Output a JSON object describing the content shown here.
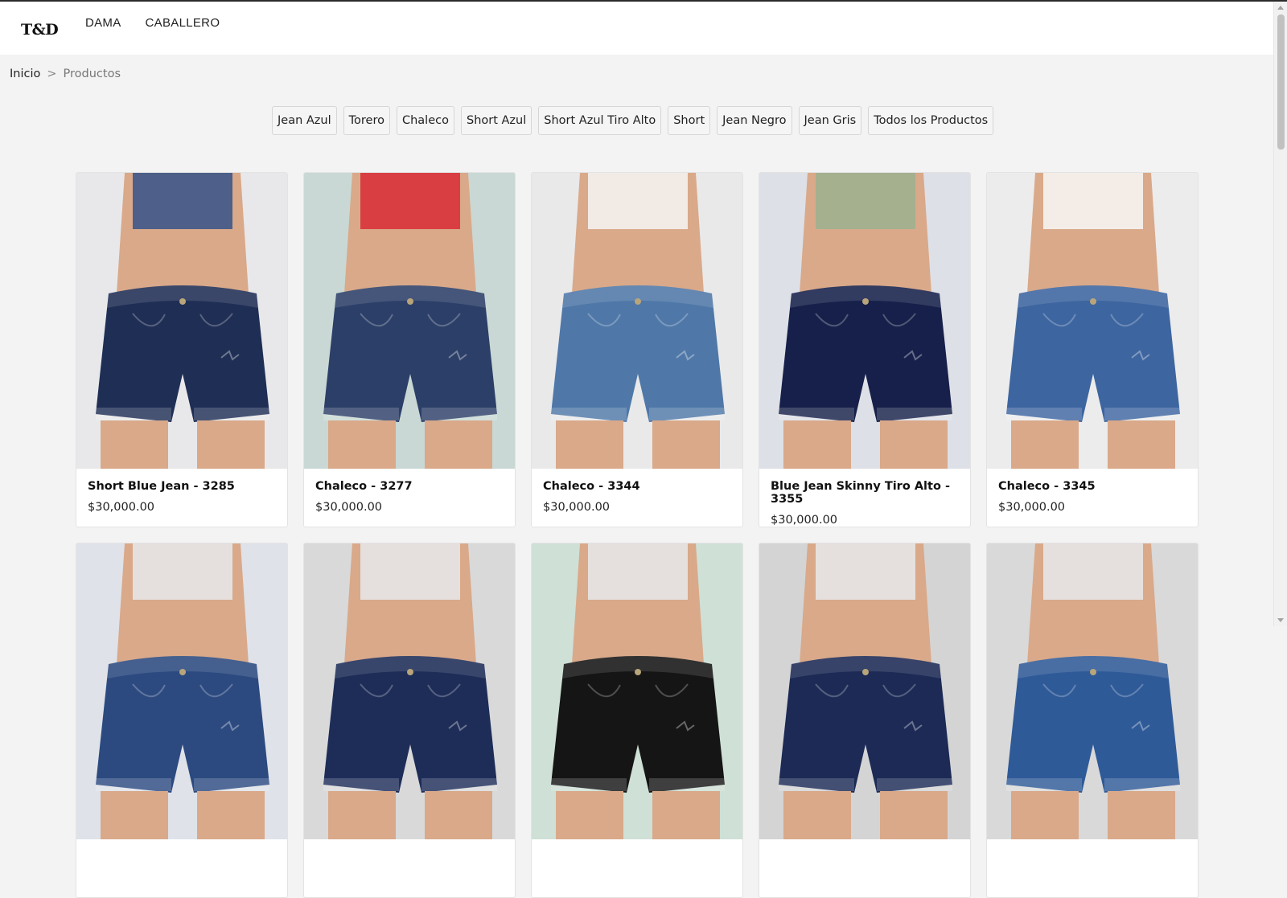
{
  "header": {
    "logo": "T&D",
    "nav": [
      "DAMA",
      "CABALLERO"
    ]
  },
  "breadcrumb": {
    "home": "Inicio",
    "separator": ">",
    "current": "Productos"
  },
  "filters": [
    "Jean Azul",
    "Torero",
    "Chaleco",
    "Short Azul",
    "Short Azul Tiro Alto",
    "Short",
    "Jean Negro",
    "Jean Gris",
    "Todos los Productos"
  ],
  "products": [
    {
      "title": "Short Blue Jean - 3285",
      "price": "$30,000.00",
      "bg": "#e8e8ea",
      "denim": "#1f2e55",
      "accent": "#3e5688"
    },
    {
      "title": "Chaleco - 3277",
      "price": "$30,000.00",
      "bg": "#c9d8d4",
      "denim": "#2c3f68",
      "accent": "#d8323a"
    },
    {
      "title": "Chaleco - 3344",
      "price": "$30,000.00",
      "bg": "#e9e9ea",
      "denim": "#4f78a8",
      "accent": "#f4f1ee"
    },
    {
      "title": "Blue Jean Skinny Tiro Alto - 3355",
      "price": "$30,000.00",
      "bg": "#dde0e6",
      "denim": "#16204a",
      "accent": "#9fb08f"
    },
    {
      "title": "Chaleco - 3345",
      "price": "$30,000.00",
      "bg": "#ececec",
      "denim": "#3d65a0",
      "accent": "#f6f4f1"
    }
  ],
  "products_row2": [
    {
      "bg": "#dfe2e8",
      "denim": "#2c4a80"
    },
    {
      "bg": "#d9d9d9",
      "denim": "#1e2d58"
    },
    {
      "bg": "#cfe0d6",
      "denim": "#151515"
    },
    {
      "bg": "#d4d4d4",
      "denim": "#1c2a55"
    },
    {
      "bg": "#d9d9d9",
      "denim": "#2f5a98"
    }
  ]
}
